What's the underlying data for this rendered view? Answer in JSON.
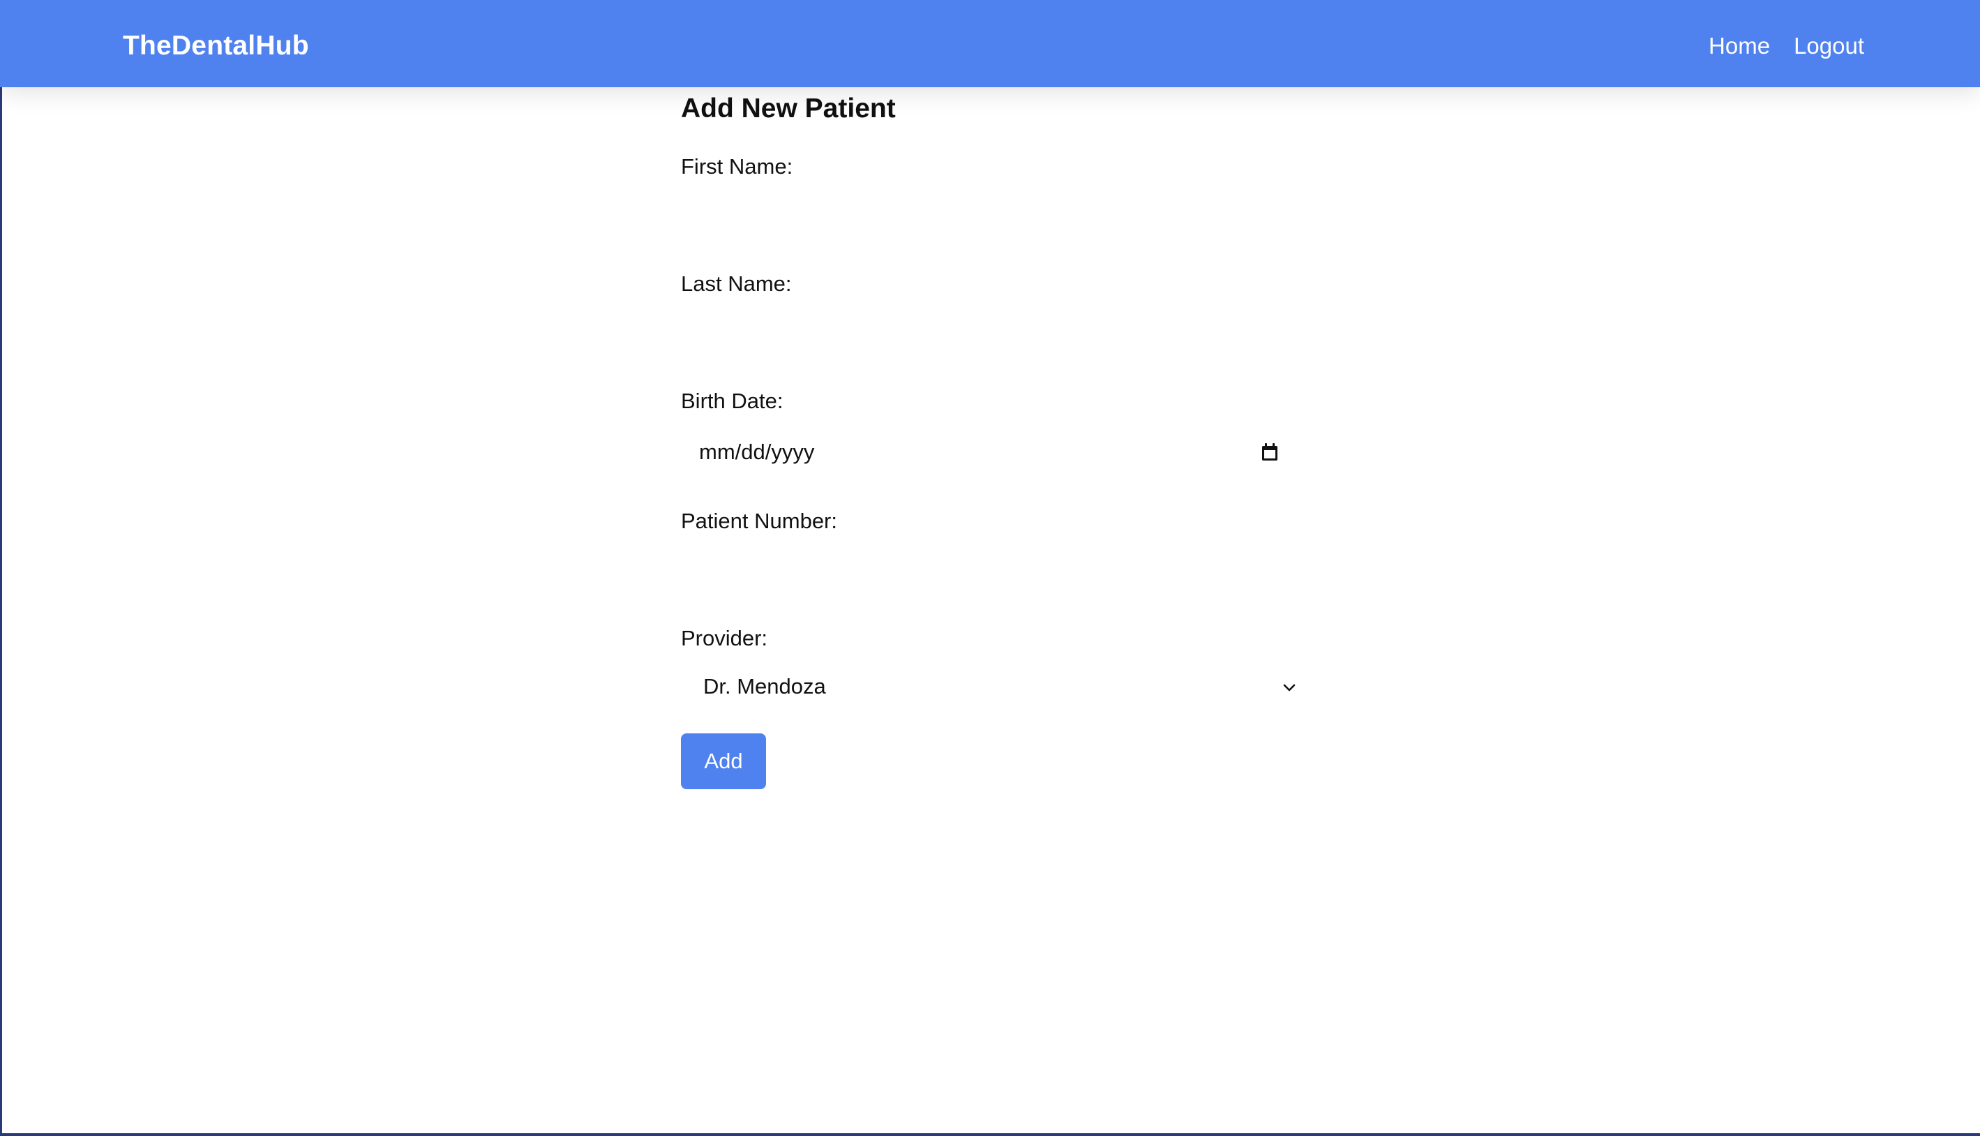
{
  "header": {
    "brand": "TheDentalHub",
    "nav": {
      "home": "Home",
      "logout": "Logout"
    }
  },
  "form": {
    "title": "Add New Patient",
    "first_name": {
      "label": "First Name:",
      "value": ""
    },
    "last_name": {
      "label": "Last Name:",
      "value": ""
    },
    "birth_date": {
      "label": "Birth Date:",
      "placeholder": "mm/dd/yyyy",
      "icon": "calendar-icon"
    },
    "patient_number": {
      "label": "Patient Number:",
      "value": ""
    },
    "provider": {
      "label": "Provider:",
      "selected": "Dr. Mendoza",
      "icon": "chevron-down-icon"
    },
    "submit_label": "Add"
  },
  "colors": {
    "accent": "#4f82ef",
    "text": "#111111",
    "background": "#ffffff"
  }
}
